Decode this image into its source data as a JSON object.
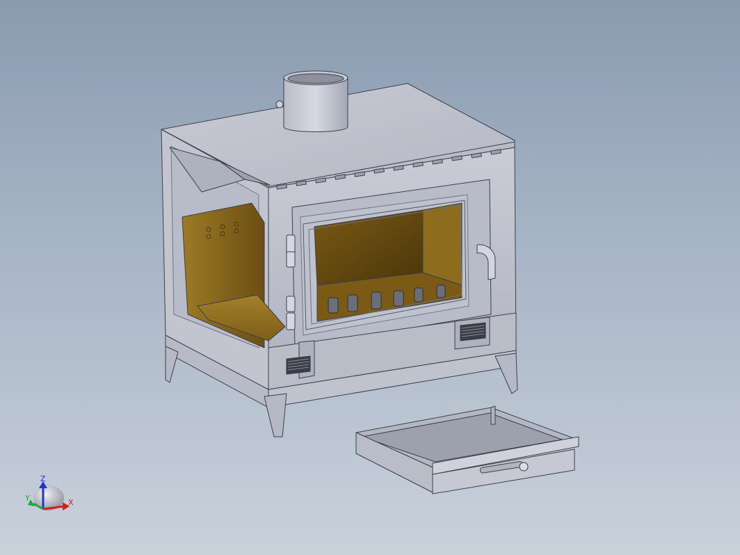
{
  "viewport": {
    "background_top": "#8a9bb0",
    "background_bottom": "#c9d1db"
  },
  "model": {
    "body_color": "#bcc0cc",
    "edge_color": "#3c3f4a",
    "firebox_color": "#8a6a1c",
    "firebox_dark": "#5a4410",
    "glass_tint": "#c3c8d4"
  },
  "triad": {
    "x_label": "X",
    "y_label": "Y",
    "z_label": "Z",
    "x_color": "#d12020",
    "y_color": "#1fa83a",
    "z_color": "#2234c8"
  }
}
